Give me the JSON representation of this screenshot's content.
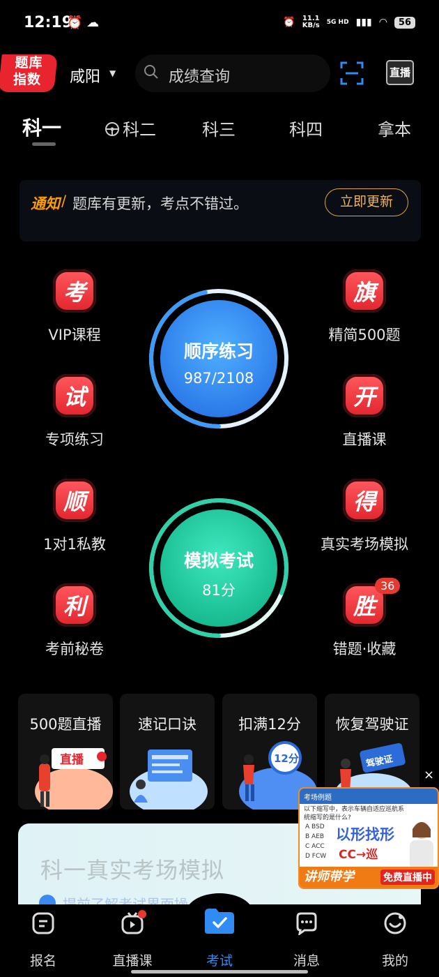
{
  "status_bar": {
    "time": "12:19",
    "net_speed_value": "11.1",
    "net_speed_unit": "KB/s",
    "signal": "5G HD",
    "battery": "56"
  },
  "header": {
    "logo_line1": "题库",
    "logo_line2": "指数",
    "city": "咸阳",
    "search_placeholder": "成绩查询",
    "live_label": "直播"
  },
  "tabs": [
    {
      "label": "科一",
      "active": true
    },
    {
      "label": "科二",
      "active": false,
      "icon": "steering-wheel-icon"
    },
    {
      "label": "科三",
      "active": false
    },
    {
      "label": "科四",
      "active": false
    },
    {
      "label": "拿本",
      "active": false
    }
  ],
  "notice": {
    "tag": "通知",
    "separator": "/",
    "text": "题库有更新，考点不错过。",
    "button": "立即更新"
  },
  "features_left": [
    {
      "badge": "考",
      "label": "VIP课程"
    },
    {
      "badge": "试",
      "label": "专项练习"
    },
    {
      "badge": "顺",
      "label": "1对1私教"
    },
    {
      "badge": "利",
      "label": "考前秘卷"
    }
  ],
  "features_right": [
    {
      "badge": "旗",
      "label": "精简500题"
    },
    {
      "badge": "开",
      "label": "直播课"
    },
    {
      "badge": "得",
      "label": "真实考场模拟"
    },
    {
      "badge": "胜",
      "label": "错题·收藏",
      "count": "36"
    }
  ],
  "sequential_practice": {
    "title": "顺序练习",
    "progress": "987/2108",
    "done": 987,
    "total": 2108,
    "color": "#3e9cf8"
  },
  "mock_exam": {
    "title": "模拟考试",
    "score": "81分",
    "score_value": 81,
    "max_score": 100,
    "color": "#2fd1a8"
  },
  "promos": [
    {
      "title": "500题直播",
      "art_text": "直播"
    },
    {
      "title": "速记口诀"
    },
    {
      "title": "扣满12分",
      "art_text": "12分"
    },
    {
      "title": "恢复驾驶证",
      "art_text": "驾驶证"
    }
  ],
  "banner": {
    "title": "科一真实考场模拟",
    "subtitle": "提前了解考试界面操"
  },
  "ad": {
    "header": "考场例题",
    "question": "以下缩写中，表示车辆自适应巡航系统缩写的是什么?",
    "options": [
      "A  BSD",
      "B  AEB",
      "C  ACC",
      "D  FCW"
    ],
    "headline": "以形找形",
    "formula": "CC→巡",
    "teacher": "讲师带学",
    "live": "免费直播中",
    "close": "×"
  },
  "bottom_nav": [
    {
      "label": "报名",
      "icon": "signup-icon"
    },
    {
      "label": "直播课",
      "icon": "tv-icon",
      "dot": true
    },
    {
      "label": "考试",
      "icon": "exam-folder-icon",
      "active": true
    },
    {
      "label": "消息",
      "icon": "message-icon"
    },
    {
      "label": "我的",
      "icon": "profile-icon"
    }
  ],
  "colors": {
    "accent_blue": "#2f8cf5",
    "badge_red": "#e2232c",
    "notice_orange": "#ff9d00"
  }
}
